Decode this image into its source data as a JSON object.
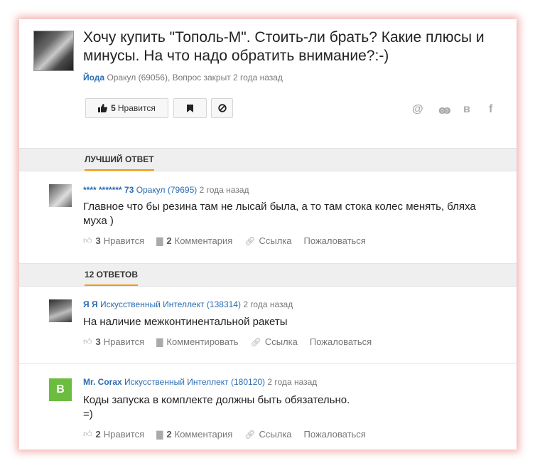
{
  "question": {
    "title": "Хочу купить \"Тополь-М\". Стоить-ли брать? Какие плюсы и минусы. На что надо обратить внимание?:-)",
    "author": "Йода",
    "rank": "Оракул (69056),",
    "status": "Вопрос закрыт 2 года назад",
    "likes_count": "5",
    "likes_label": "Нравится",
    "share_icons": [
      "at-icon",
      "odnoklassniki-icon",
      "vk-icon",
      "facebook-icon"
    ]
  },
  "best_answer_label": "ЛУЧШИЙ ОТВЕТ",
  "answers_count_label": "12 ОТВЕТОВ",
  "best_answer": {
    "author": "**** ******* 73",
    "rank": "Оракул (79695)",
    "time": "2 года назад",
    "text": "Главное что бы резина там не лысай была, а то там стока колес менять, бляха муха )",
    "likes": "3",
    "likes_label": "Нравится",
    "comments": "2",
    "comments_label": "Комментария",
    "link_label": "Ссылка",
    "report_label": "Пожаловаться"
  },
  "answers": [
    {
      "author": "Я Я",
      "rank": "Искусственный Интеллект (138314)",
      "time": "2 года назад",
      "text": "На наличие межконтинентальной ракеты",
      "likes": "3",
      "likes_label": "Нравится",
      "comments_label": "Комментировать",
      "link_label": "Ссылка",
      "report_label": "Пожаловаться"
    },
    {
      "avatar_letter": "В",
      "author": "Mr. Сorax",
      "rank": "Искусственный Интеллект (180120)",
      "time": "2 года назад",
      "text_line1": "Коды запуска в комплекте должны быть обязательно.",
      "text_line2": "=)",
      "likes": "2",
      "likes_label": "Нравится",
      "comments": "2",
      "comments_label": "Комментария",
      "link_label": "Ссылка",
      "report_label": "Пожаловаться"
    }
  ],
  "colors": {
    "link": "#2b6cb3",
    "accent_underline": "#f59a00",
    "avatar_green": "#6cbc3f"
  }
}
